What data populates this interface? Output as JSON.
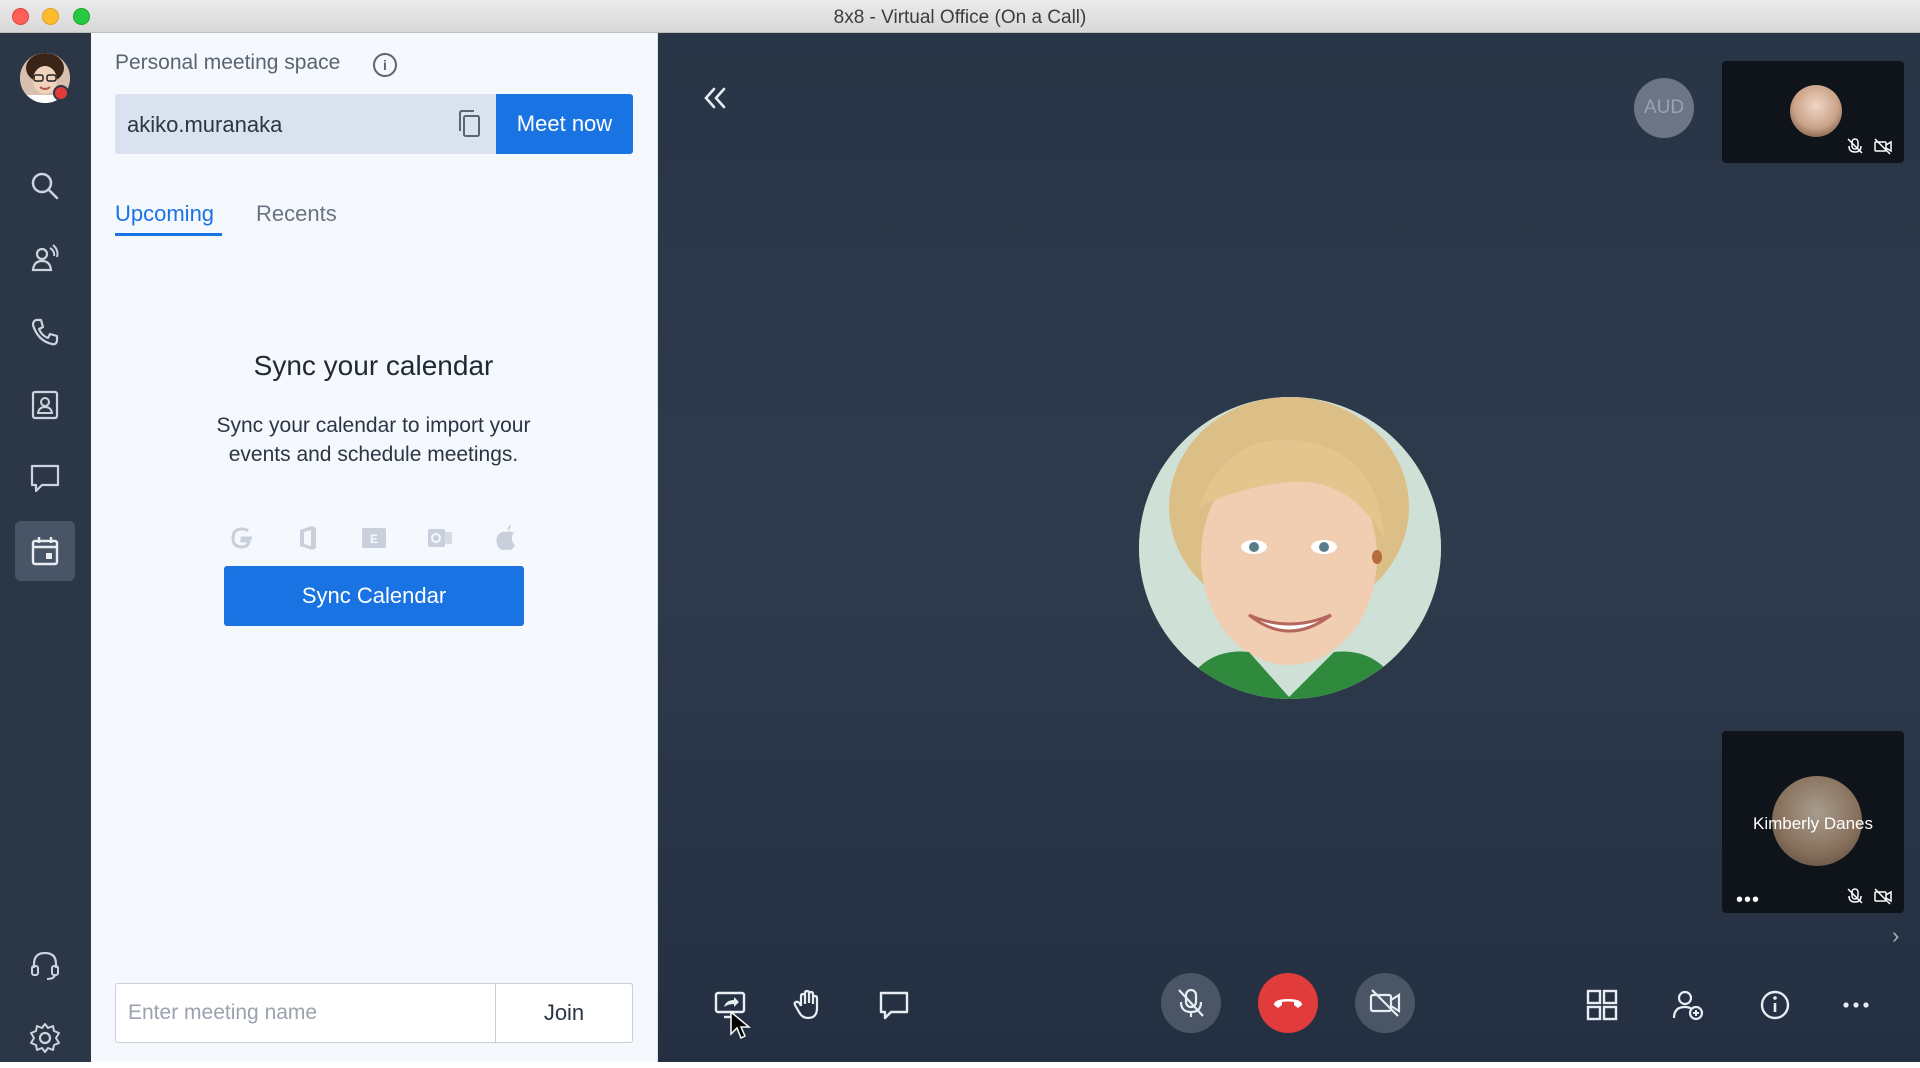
{
  "window": {
    "title": "8x8 - Virtual Office (On a Call)"
  },
  "nav": {
    "items": [
      {
        "name": "search",
        "icon": "search-icon"
      },
      {
        "name": "contacts-team",
        "icon": "team-icon"
      },
      {
        "name": "phone",
        "icon": "phone-icon"
      },
      {
        "name": "directory",
        "icon": "contact-card-icon"
      },
      {
        "name": "messages",
        "icon": "chat-icon"
      },
      {
        "name": "meetings",
        "icon": "calendar-icon",
        "active": true
      }
    ],
    "bottom": [
      {
        "name": "support",
        "icon": "headset-icon"
      },
      {
        "name": "settings",
        "icon": "gear-icon"
      }
    ]
  },
  "panel": {
    "pms_label": "Personal meeting space",
    "pms_value": "akiko.muranaka",
    "meet_now_label": "Meet now",
    "tabs": [
      {
        "label": "Upcoming",
        "active": true
      },
      {
        "label": "Recents",
        "active": false
      }
    ],
    "sync_title": "Sync your calendar",
    "sync_desc_line1": "Sync your calendar to import your",
    "sync_desc_line2": "events and schedule meetings.",
    "calendar_providers": [
      "google-icon",
      "office-icon",
      "exchange-icon",
      "outlook-icon",
      "apple-icon"
    ],
    "sync_button_label": "Sync Calendar",
    "join_placeholder": "Enter meeting name",
    "join_label": "Join"
  },
  "call": {
    "aud_label": "AUD",
    "participant_bottom_name": "Kimberly Danes",
    "controls_left": [
      "share-screen-icon",
      "raise-hand-icon",
      "chat-icon"
    ],
    "controls_center": [
      "mic-off-icon",
      "hang-up-icon",
      "video-off-icon"
    ],
    "controls_right": [
      "grid-view-icon",
      "add-participant-icon",
      "info-icon",
      "more-icon"
    ]
  },
  "colors": {
    "accent": "#1a73e2",
    "nav_bg": "#2b3747",
    "call_bg": "#2e3b4d",
    "hangup": "#e23b3b"
  }
}
